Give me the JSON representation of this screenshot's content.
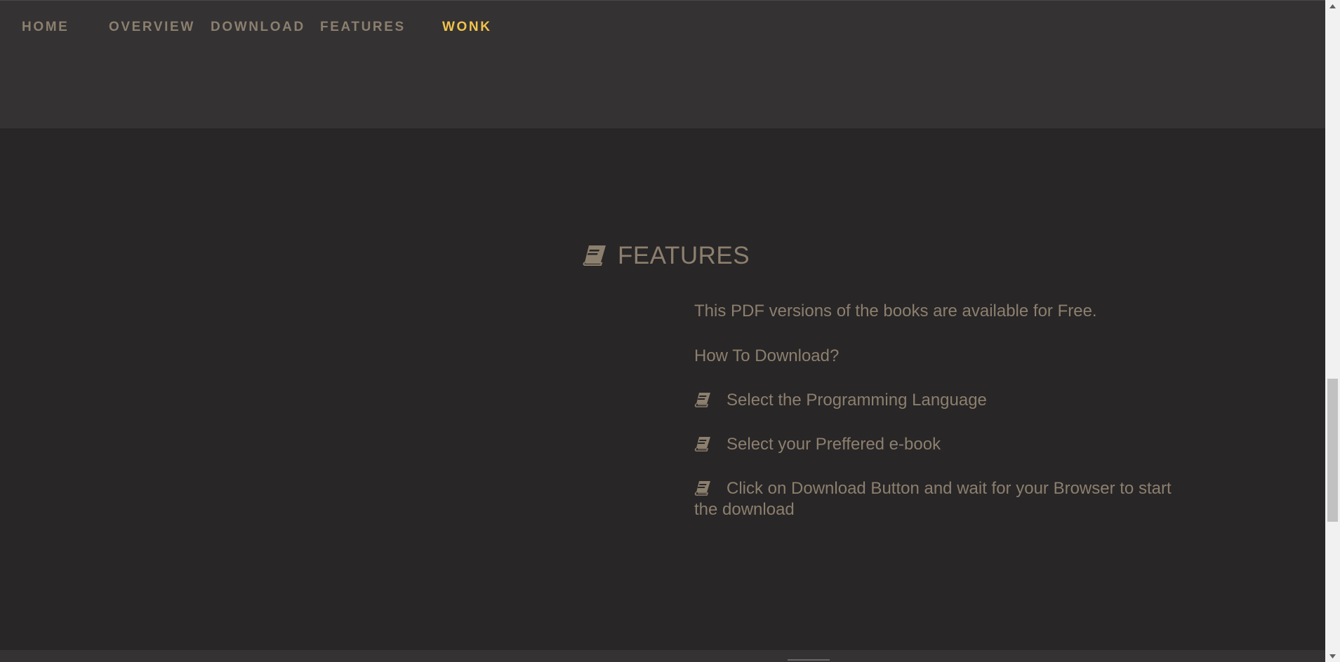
{
  "nav": {
    "items": [
      {
        "label": "HOME"
      },
      {
        "label": "OVERVIEW"
      },
      {
        "label": "DOWNLOAD"
      },
      {
        "label": "FEATURES"
      },
      {
        "label": "WONK"
      }
    ],
    "active_color": "#f0c34b",
    "link_color": "#8c7f6e"
  },
  "features": {
    "title": "FEATURES",
    "icon": "book-icon",
    "intro": "This PDF versions of the books are available for Free.",
    "how_to": "How To Download?",
    "steps": [
      {
        "text": "Select the Programming Language",
        "icon": "book-icon"
      },
      {
        "text": "Select your Preffered e-book",
        "icon": "book-icon"
      },
      {
        "text": "Click on Download Button and wait for your Browser to start the download",
        "icon": "book-icon"
      }
    ]
  },
  "colors": {
    "background": "#282627",
    "header": "#343233",
    "text": "#8c7f6e"
  }
}
